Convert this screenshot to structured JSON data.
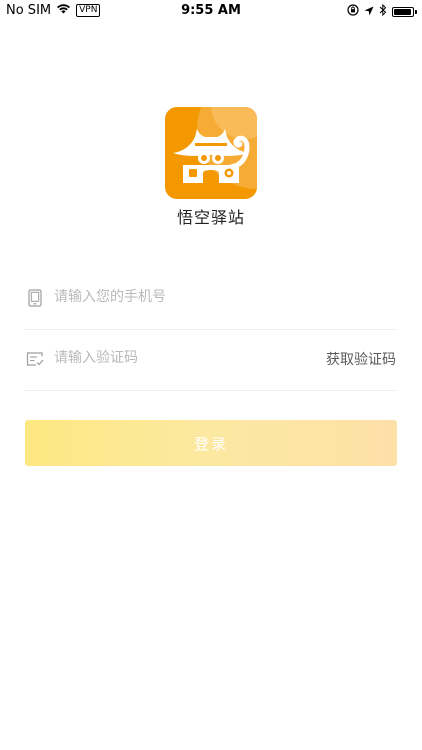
{
  "status_bar": {
    "carrier": "No SIM",
    "vpn": "VPN",
    "time": "9:55 AM",
    "battery_level": 0.95
  },
  "brand": {
    "app_name": "悟空驿站",
    "logo_bg_color": "#f39800",
    "logo_icon": "monkey-house-logo"
  },
  "form": {
    "phone": {
      "icon": "phone-icon",
      "placeholder": "请输入您的手机号",
      "value": ""
    },
    "code": {
      "icon": "verify-code-icon",
      "placeholder": "请输入验证码",
      "value": "",
      "get_code_label": "获取验证码"
    },
    "login_label": "登录"
  },
  "colors": {
    "accent": "#fde68a",
    "placeholder": "#b9b9b9",
    "divider": "#ededed"
  }
}
